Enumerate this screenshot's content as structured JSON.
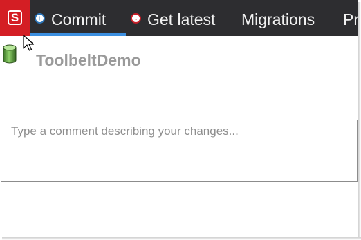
{
  "app": {
    "logo_glyph": "S",
    "accent_color": "#3c8fe0",
    "brand_color": "#d41e24"
  },
  "tabs": [
    {
      "label": "Commit",
      "icon": "upload-circle-icon",
      "active": true
    },
    {
      "label": "Get latest",
      "icon": "download-circle-icon",
      "active": false
    },
    {
      "label": "Migrations",
      "active": false
    },
    {
      "label": "Pr",
      "active": false
    }
  ],
  "repo": {
    "title": "ToolbeltDemo",
    "icon": "database-icon"
  },
  "comment": {
    "value": "",
    "placeholder": "Type a comment describing your changes..."
  }
}
